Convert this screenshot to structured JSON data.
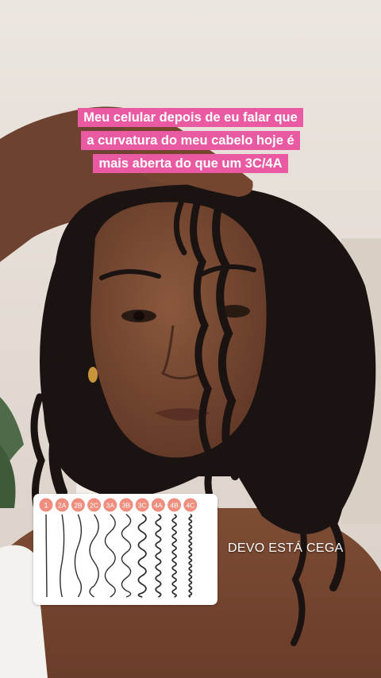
{
  "caption": {
    "line1": "Meu celular depois de eu falar que",
    "line2": "a curvatura do meu cabelo hoje é",
    "line3": "mais aberta do que um 3C/4A"
  },
  "overlay_text": "DEVO ESTÁ CEGA",
  "curl_chart": {
    "types": [
      "1",
      "2A",
      "2B",
      "2C",
      "3A",
      "3B",
      "3C",
      "4A",
      "4B",
      "4C"
    ],
    "badge_color": "#ef8e7f",
    "line_color": "#2d2d2d"
  },
  "colors": {
    "caption_bg": "#ea5aa2",
    "caption_text": "#ffffff",
    "wall": "#e9e2dc",
    "skin": "#7a4a33",
    "hair": "#1b1311"
  }
}
